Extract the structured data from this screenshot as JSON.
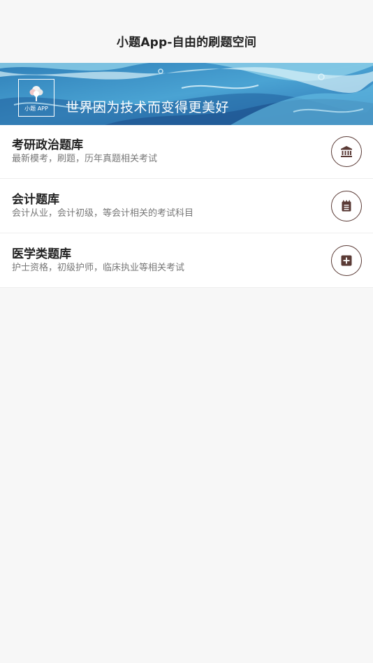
{
  "header": {
    "title": "小题App-自由的刷题空间"
  },
  "banner": {
    "logo_text": "小题 APP",
    "slogan": "世界因为技术而变得更美好"
  },
  "categories": [
    {
      "title": "考研政治题库",
      "description": "最新模考，刷题，历年真题相关考试",
      "icon": "bank-icon"
    },
    {
      "title": "会计题库",
      "description": "会计从业，会计初级，等会计相关的考试科目",
      "icon": "notepad-icon"
    },
    {
      "title": "医学类题库",
      "description": "护士资格，初级护师，临床执业等相关考试",
      "icon": "medical-plus-icon"
    }
  ],
  "colors": {
    "icon_stroke": "#5a3a35",
    "banner_blue": "#3a8fc4"
  }
}
